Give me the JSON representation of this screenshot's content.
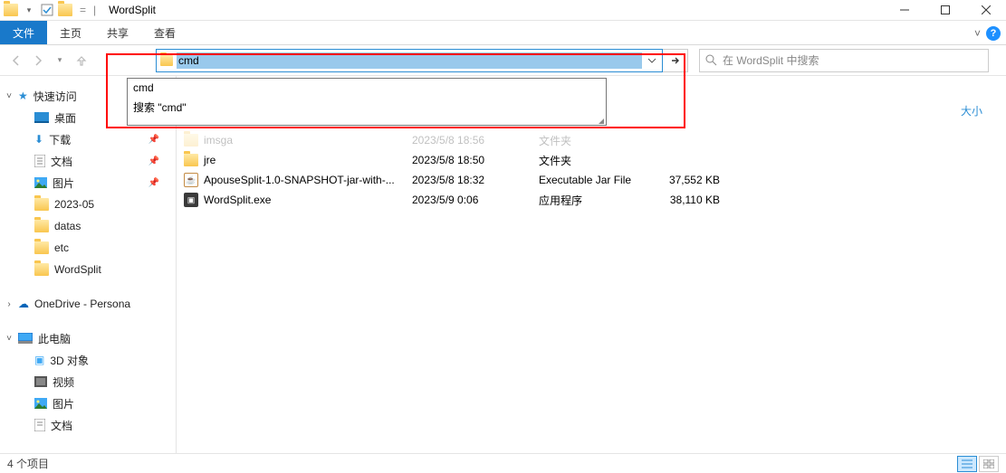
{
  "titlebar": {
    "title": "WordSplit"
  },
  "ribbon": {
    "file": "文件",
    "tabs": [
      "主页",
      "共享",
      "查看"
    ]
  },
  "nav": {
    "address_value": "cmd",
    "dropdown": {
      "items": [
        "cmd",
        "搜索 \"cmd\""
      ]
    },
    "search_placeholder": "在 WordSplit 中搜索"
  },
  "header_size_label": "大小",
  "sidebar": {
    "quick": {
      "label": "快速访问"
    },
    "desktop": "桌面",
    "downloads": "下载",
    "documents": "文档",
    "pictures": "图片",
    "folder_2023": "2023-05",
    "folder_datas": "datas",
    "folder_etc": "etc",
    "folder_wordsplit": "WordSplit",
    "onedrive": "OneDrive - Persona",
    "thispc": "此电脑",
    "obj3d": "3D 对象",
    "videos": "视频",
    "pictures2": "图片",
    "documents2": "文档"
  },
  "files": [
    {
      "name": "imsga",
      "date": "2023/5/8 18:56",
      "type": "文件夹",
      "size": ""
    },
    {
      "name": "jre",
      "date": "2023/5/8 18:50",
      "type": "文件夹",
      "size": ""
    },
    {
      "name": "ApouseSplit-1.0-SNAPSHOT-jar-with-...",
      "date": "2023/5/8 18:32",
      "type": "Executable Jar File",
      "size": "37,552 KB"
    },
    {
      "name": "WordSplit.exe",
      "date": "2023/5/9 0:06",
      "type": "应用程序",
      "size": "38,110 KB"
    }
  ],
  "status": {
    "count": "4 个项目"
  }
}
